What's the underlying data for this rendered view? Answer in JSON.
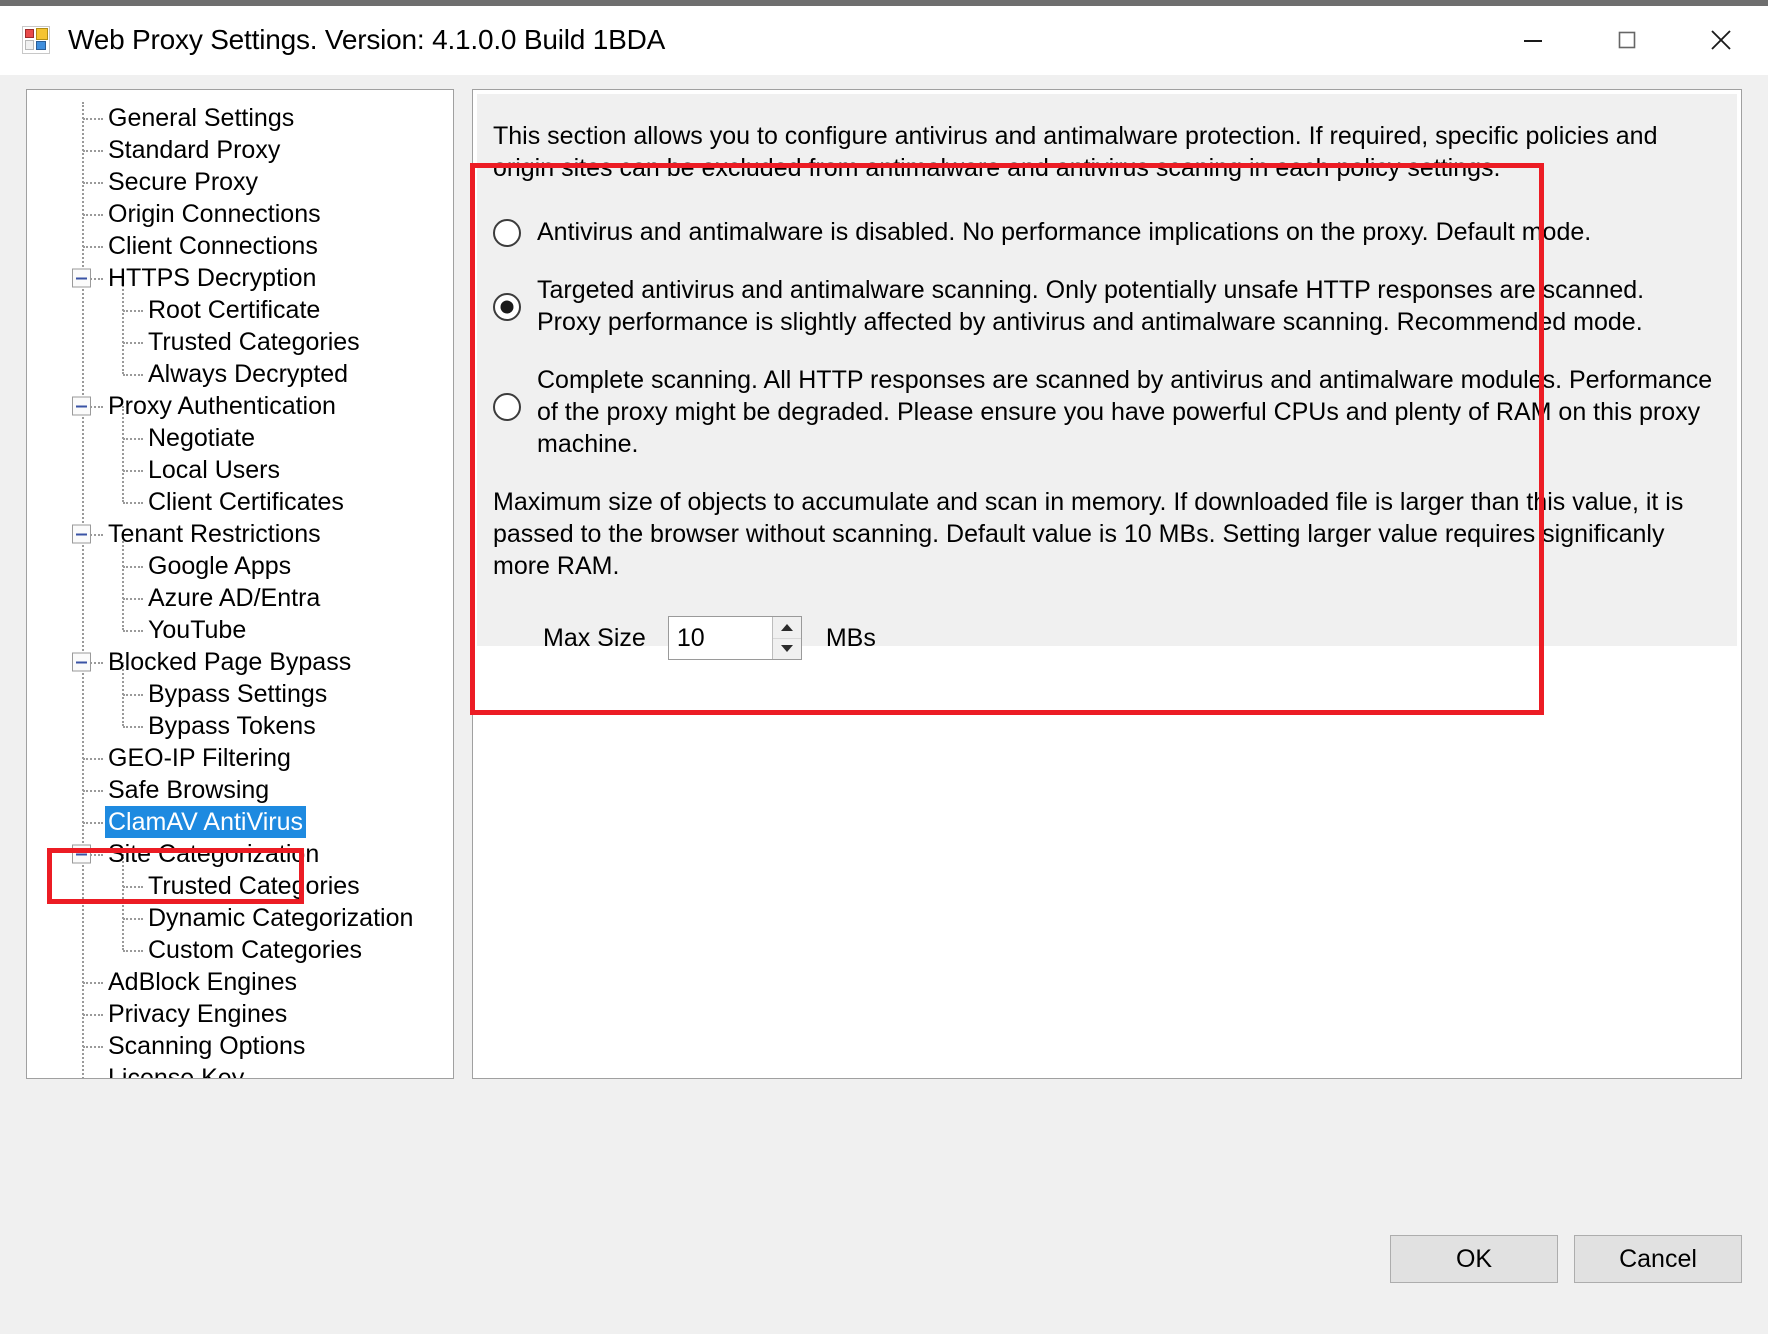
{
  "window": {
    "title": "Web Proxy Settings. Version: 4.1.0.0 Build 1BDA",
    "icon": "app-tiles-icon",
    "minimize_label": "–",
    "maximize_label": "□",
    "close_label": "✕"
  },
  "tree": {
    "items": [
      {
        "label": "General Settings",
        "level": 0,
        "expander": false,
        "selected": false
      },
      {
        "label": "Standard Proxy",
        "level": 0,
        "expander": false,
        "selected": false
      },
      {
        "label": "Secure Proxy",
        "level": 0,
        "expander": false,
        "selected": false
      },
      {
        "label": "Origin Connections",
        "level": 0,
        "expander": false,
        "selected": false
      },
      {
        "label": "Client Connections",
        "level": 0,
        "expander": false,
        "selected": false
      },
      {
        "label": "HTTPS Decryption",
        "level": 0,
        "expander": true,
        "selected": false
      },
      {
        "label": "Root Certificate",
        "level": 1,
        "expander": false,
        "selected": false
      },
      {
        "label": "Trusted Categories",
        "level": 1,
        "expander": false,
        "selected": false
      },
      {
        "label": "Always Decrypted",
        "level": 1,
        "expander": false,
        "selected": false
      },
      {
        "label": "Proxy Authentication",
        "level": 0,
        "expander": true,
        "selected": false
      },
      {
        "label": "Negotiate",
        "level": 1,
        "expander": false,
        "selected": false
      },
      {
        "label": "Local Users",
        "level": 1,
        "expander": false,
        "selected": false
      },
      {
        "label": "Client Certificates",
        "level": 1,
        "expander": false,
        "selected": false
      },
      {
        "label": "Tenant Restrictions",
        "level": 0,
        "expander": true,
        "selected": false
      },
      {
        "label": "Google Apps",
        "level": 1,
        "expander": false,
        "selected": false
      },
      {
        "label": "Azure AD/Entra",
        "level": 1,
        "expander": false,
        "selected": false
      },
      {
        "label": "YouTube",
        "level": 1,
        "expander": false,
        "selected": false
      },
      {
        "label": "Blocked Page Bypass",
        "level": 0,
        "expander": true,
        "selected": false
      },
      {
        "label": "Bypass Settings",
        "level": 1,
        "expander": false,
        "selected": false
      },
      {
        "label": "Bypass Tokens",
        "level": 1,
        "expander": false,
        "selected": false
      },
      {
        "label": "GEO-IP Filtering",
        "level": 0,
        "expander": false,
        "selected": false
      },
      {
        "label": "Safe Browsing",
        "level": 0,
        "expander": false,
        "selected": false
      },
      {
        "label": "ClamAV AntiVirus",
        "level": 0,
        "expander": false,
        "selected": true
      },
      {
        "label": "Site Categorization",
        "level": 0,
        "expander": true,
        "selected": false
      },
      {
        "label": "Trusted Categories",
        "level": 1,
        "expander": false,
        "selected": false
      },
      {
        "label": "Dynamic Categorization",
        "level": 1,
        "expander": false,
        "selected": false
      },
      {
        "label": "Custom Categories",
        "level": 1,
        "expander": false,
        "selected": false
      },
      {
        "label": "AdBlock Engines",
        "level": 0,
        "expander": false,
        "selected": false
      },
      {
        "label": "Privacy Engines",
        "level": 0,
        "expander": false,
        "selected": false
      },
      {
        "label": "Scanning Options",
        "level": 0,
        "expander": false,
        "selected": false
      },
      {
        "label": "License Key",
        "level": 0,
        "expander": false,
        "selected": false
      }
    ]
  },
  "main": {
    "intro": "This section allows you to configure antivirus and antimalware protection. If required, specific policies and origin sites can be excluded from antimalware and antivirus scaning in each policy settings.",
    "options": [
      {
        "text": "Antivirus and antimalware is disabled. No performance implications on the proxy. Default mode.",
        "selected": false,
        "lines": 1
      },
      {
        "text": "Targeted antivirus and antimalware scanning. Only potentially unsafe HTTP responses are scanned. Proxy performance is slightly affected by antivirus and antimalware scanning. Recommended mode.",
        "selected": true,
        "lines": 2
      },
      {
        "text": "Complete scanning. All HTTP responses are scanned by antivirus and antimalware modules. Performance of the proxy might be degraded. Please ensure you have powerful CPUs and plenty of RAM on this proxy machine.",
        "selected": false,
        "lines": 3
      }
    ],
    "maxsize_description": "Maximum size of objects to accumulate and scan in memory. If downloaded file is larger than this value, it is passed to the browser without scanning. Default value is 10 MBs. Setting larger value requires significanly more RAM.",
    "maxsize_label": "Max Size",
    "maxsize_value": "10",
    "maxsize_units": "MBs",
    "spin_up_icon": "arrow-up-icon",
    "spin_down_icon": "arrow-down-icon"
  },
  "footer": {
    "ok_label": "OK",
    "cancel_label": "Cancel"
  },
  "colors": {
    "accent_selection": "#1e8ae0",
    "annotation": "#ec1c24",
    "panel_background": "#f0f0f0",
    "window_background": "#ffffff"
  }
}
